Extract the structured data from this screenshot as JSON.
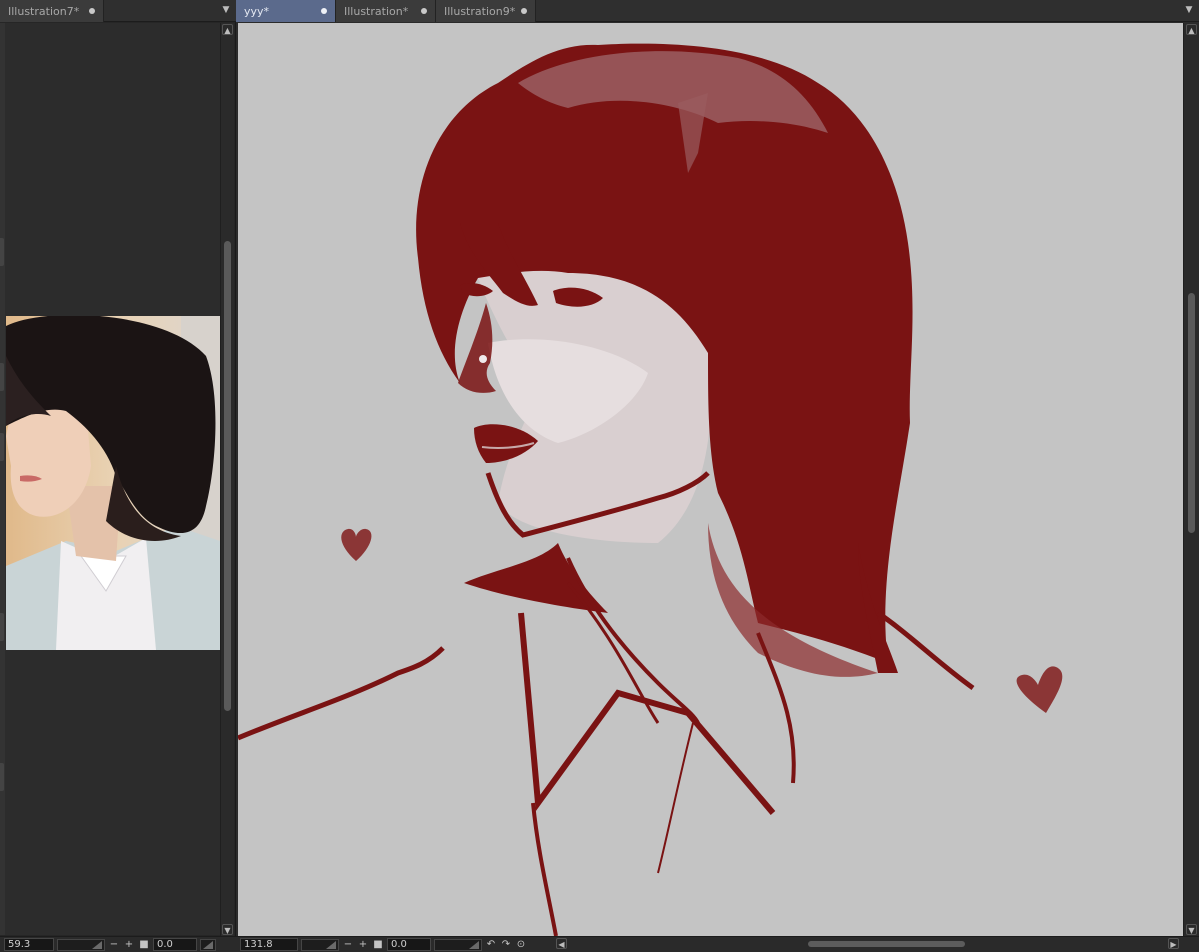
{
  "left_pane": {
    "tabs": [
      {
        "label": "Illustration7*",
        "active": false,
        "modified_dot": true
      }
    ],
    "zoom_value": "59.3",
    "rotation_value": "0.0"
  },
  "right_pane": {
    "tabs": [
      {
        "label": "yyy*",
        "active": true,
        "modified_dot": true
      },
      {
        "label": "Illustration*",
        "active": false,
        "modified_dot": true
      },
      {
        "label": "Illustration9*",
        "active": false,
        "modified_dot": true
      }
    ],
    "zoom_value": "131.8",
    "rotation_value": "0.0"
  },
  "icons": {
    "tab_menu": "chevron-down-icon",
    "scroll_up": "chevron-up-icon",
    "scroll_down": "chevron-down-icon",
    "scroll_left": "chevron-left-icon",
    "scroll_right": "chevron-right-icon",
    "zoom_out": "minus-icon",
    "zoom_in": "plus-icon",
    "fit": "square-icon",
    "rotate_left": "rotate-ccw-icon",
    "rotate_right": "rotate-cw-icon",
    "reset_rotation": "reset-rotation-icon"
  },
  "colors": {
    "active_tab": "#5b6a8c",
    "canvas_bg": "#c4c4c4",
    "ink": "#7a1313",
    "panel_bg": "#2b2b2b"
  }
}
